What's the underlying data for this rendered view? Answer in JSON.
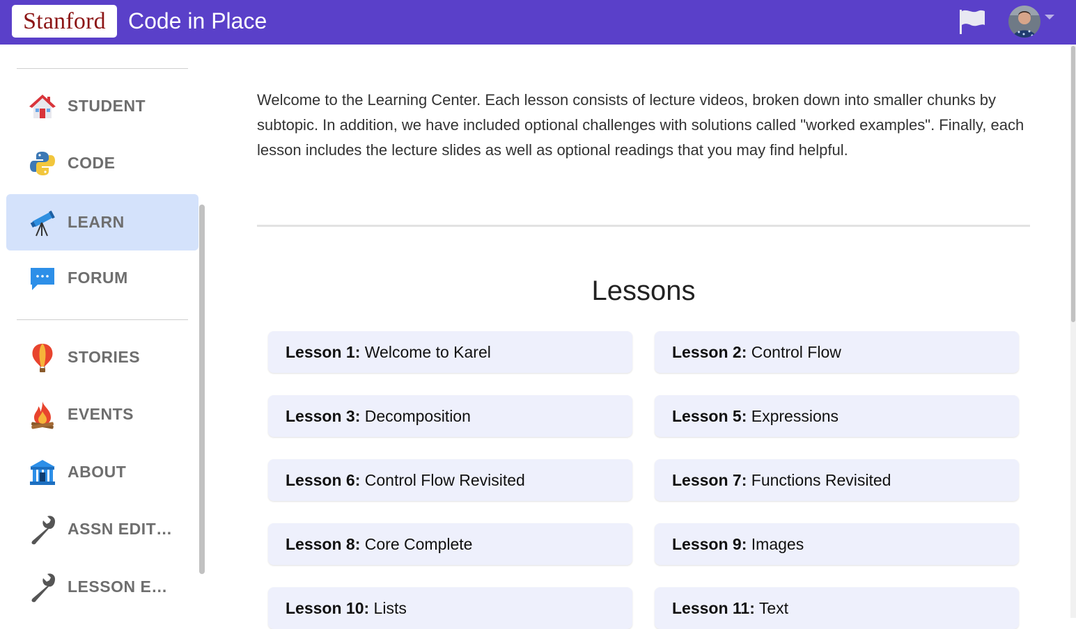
{
  "header": {
    "logo_text": "Stanford",
    "app_title": "Code in Place",
    "flag_icon": "flag-icon",
    "avatar": "user-avatar"
  },
  "sidebar": {
    "items": [
      {
        "label": "STUDENT",
        "icon": "house-icon",
        "active": false
      },
      {
        "label": "CODE",
        "icon": "python-icon",
        "active": false
      },
      {
        "label": "LEARN",
        "icon": "telescope-icon",
        "active": true
      },
      {
        "label": "FORUM",
        "icon": "chat-bubble-icon",
        "active": false
      },
      {
        "label": "STORIES",
        "icon": "balloon-icon",
        "active": false
      },
      {
        "label": "EVENTS",
        "icon": "campfire-icon",
        "active": false
      },
      {
        "label": "ABOUT",
        "icon": "building-icon",
        "active": false
      },
      {
        "label": "ASSN EDIT…",
        "icon": "wrench-icon",
        "active": false
      },
      {
        "label": "LESSON E…",
        "icon": "wrench-icon",
        "active": false
      }
    ]
  },
  "main": {
    "intro": "Welcome to the Learning Center. Each lesson consists of lecture videos, broken down into smaller chunks by subtopic. In addition, we have included optional challenges with solutions called \"worked examples\". Finally, each lesson includes the lecture slides as well as optional readings that you may find helpful.",
    "lessons_title": "Lessons",
    "lessons": [
      {
        "num": "Lesson 1:",
        "title": "Welcome to Karel"
      },
      {
        "num": "Lesson 2:",
        "title": "Control Flow"
      },
      {
        "num": "Lesson 3:",
        "title": "Decomposition"
      },
      {
        "num": "Lesson 5:",
        "title": "Expressions"
      },
      {
        "num": "Lesson 6:",
        "title": "Control Flow Revisited"
      },
      {
        "num": "Lesson 7:",
        "title": "Functions Revisited"
      },
      {
        "num": "Lesson 8:",
        "title": "Core Complete"
      },
      {
        "num": "Lesson 9:",
        "title": "Images"
      },
      {
        "num": "Lesson 10:",
        "title": "Lists"
      },
      {
        "num": "Lesson 11:",
        "title": "Text"
      }
    ]
  },
  "colors": {
    "topbar": "#5a40c9",
    "active_nav": "#d4e2fb",
    "lesson_card": "#eef0fc",
    "stanford_red": "#8c1515"
  }
}
